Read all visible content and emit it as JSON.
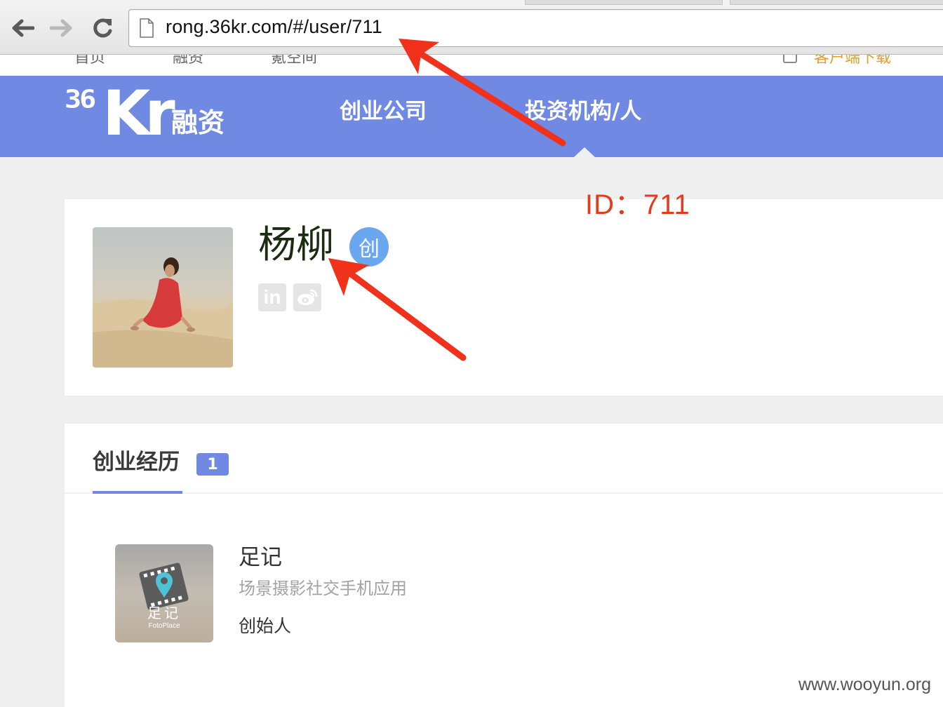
{
  "browser": {
    "url": "rong.36kr.com/#/user/711"
  },
  "topstrip": {
    "ghost_items": [
      "首页",
      "融资",
      "氪空间"
    ],
    "right_items": [
      "客户端下载"
    ]
  },
  "header": {
    "logo_number": "36",
    "logo_letters": "Kr",
    "logo_product": "融资",
    "nav": [
      "创业公司",
      "投资机构/人"
    ],
    "active_nav": "投资机构/人",
    "bg_color": "#7089e2"
  },
  "profile": {
    "name": "杨柳",
    "role_badge": "创",
    "social_icons": [
      "linkedin-icon",
      "weibo-icon"
    ]
  },
  "annotation": {
    "id_label": "ID：711",
    "arrow_color": "#f0321c"
  },
  "experience": {
    "tab_title": "创业经历",
    "count": "1",
    "company": {
      "logo_text": "足记",
      "logo_subtext": "FotoPlace",
      "name": "足记",
      "description": "场景摄影社交手机应用",
      "role": "创始人"
    }
  },
  "watermark": "www.wooyun.org"
}
